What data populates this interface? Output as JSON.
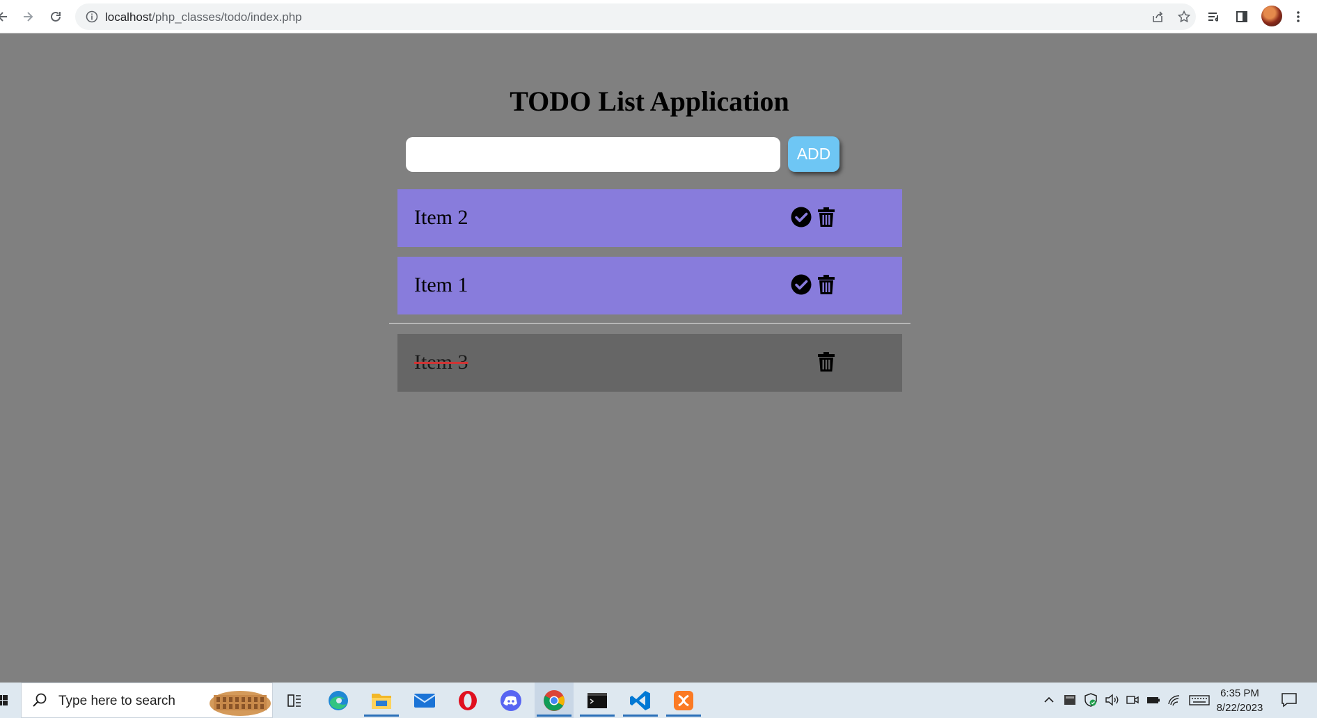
{
  "browser": {
    "url_host": "localhost",
    "url_path": "/php_classes/todo/index.php"
  },
  "page": {
    "title": "TODO List Application",
    "input": {
      "value": "",
      "placeholder": ""
    },
    "add_label": "ADD",
    "pending_items": [
      {
        "label": "Item 2"
      },
      {
        "label": "Item 1"
      }
    ],
    "completed_items": [
      {
        "label": "Item 3"
      }
    ],
    "colors": {
      "pending_bg": "#887cdc",
      "completed_bg": "#666666",
      "add_button": "#6ec6f4",
      "strike": "#d13434"
    }
  },
  "taskbar": {
    "search_placeholder": "Type here to search",
    "apps": [
      "task-view",
      "edge",
      "file-explorer",
      "mail",
      "opera",
      "discord",
      "chrome",
      "terminal",
      "vscode",
      "xampp"
    ],
    "time": "6:35 PM",
    "date": "8/22/2023"
  }
}
